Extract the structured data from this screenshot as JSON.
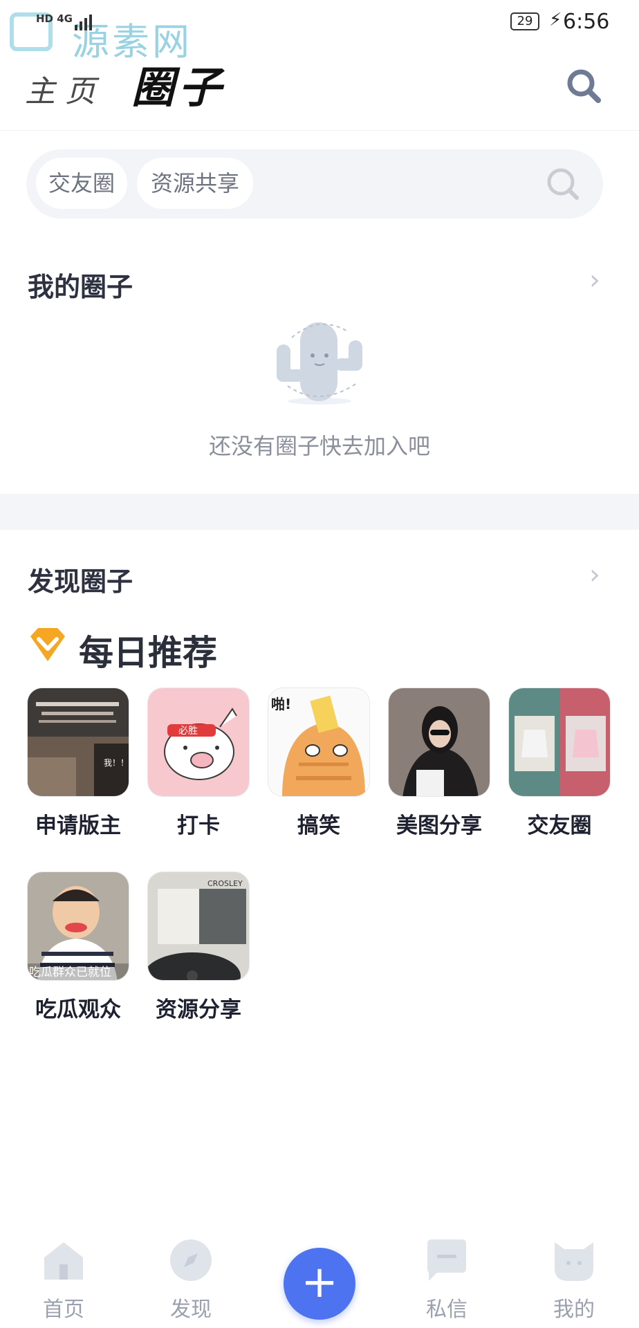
{
  "status_bar": {
    "network_hd": "HD",
    "network_gen": "4G",
    "battery": "29",
    "time": "6:56",
    "watermark": "源素网"
  },
  "header": {
    "home_label": "主页",
    "title": "圈子",
    "search_icon": "search-icon"
  },
  "search_bar": {
    "chips": [
      "交友圈",
      "资源共享"
    ],
    "search_icon": "search-icon"
  },
  "my_circles": {
    "title": "我的圈子",
    "empty_text": "还没有圈子快去加入吧",
    "empty_icon": "cactus-icon"
  },
  "discover": {
    "title": "发现圈子",
    "daily_title": "每日推荐",
    "daily_icon": "diamond-badge-icon",
    "items": [
      {
        "label": "申请版主",
        "thumb_text": "我！！"
      },
      {
        "label": "打卡",
        "thumb_text": "必胜"
      },
      {
        "label": "搞笑",
        "thumb_text": "啪!"
      },
      {
        "label": "美图分享"
      },
      {
        "label": "交友圈"
      },
      {
        "label": "吃瓜观众",
        "thumb_text": "吃瓜群众已就位"
      },
      {
        "label": "资源分享",
        "thumb_text": "CROSLEY"
      }
    ]
  },
  "bottom_nav": {
    "items": [
      {
        "label": "首页",
        "icon": "home-icon"
      },
      {
        "label": "发现",
        "icon": "compass-icon"
      },
      {
        "label": "",
        "icon": "plus-icon"
      },
      {
        "label": "私信",
        "icon": "message-icon"
      },
      {
        "label": "我的",
        "icon": "profile-icon"
      }
    ]
  },
  "colors": {
    "accent": "#4d73f0",
    "badge": "#f5a623",
    "nav_icon": "#dfe3ea"
  }
}
